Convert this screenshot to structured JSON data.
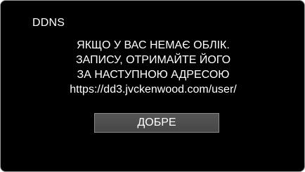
{
  "dialog": {
    "title": "DDNS",
    "message_lines": [
      "ЯКЩО У ВАС НЕМАЄ ОБЛІК.",
      "ЗАПИСУ, ОТРИМАЙТЕ ЙОГО",
      "ЗА НАСТУПНОЮ АДРЕСОЮ",
      "https://dd3.jvckenwood.com/user/"
    ],
    "ok_label": "ДОБРЕ"
  },
  "colors": {
    "background": "#000000",
    "text": "#ffffff",
    "button_fill": "#4d4d4d",
    "button_border": "#8a8a8a",
    "frame_border": "#9a9a9a"
  }
}
